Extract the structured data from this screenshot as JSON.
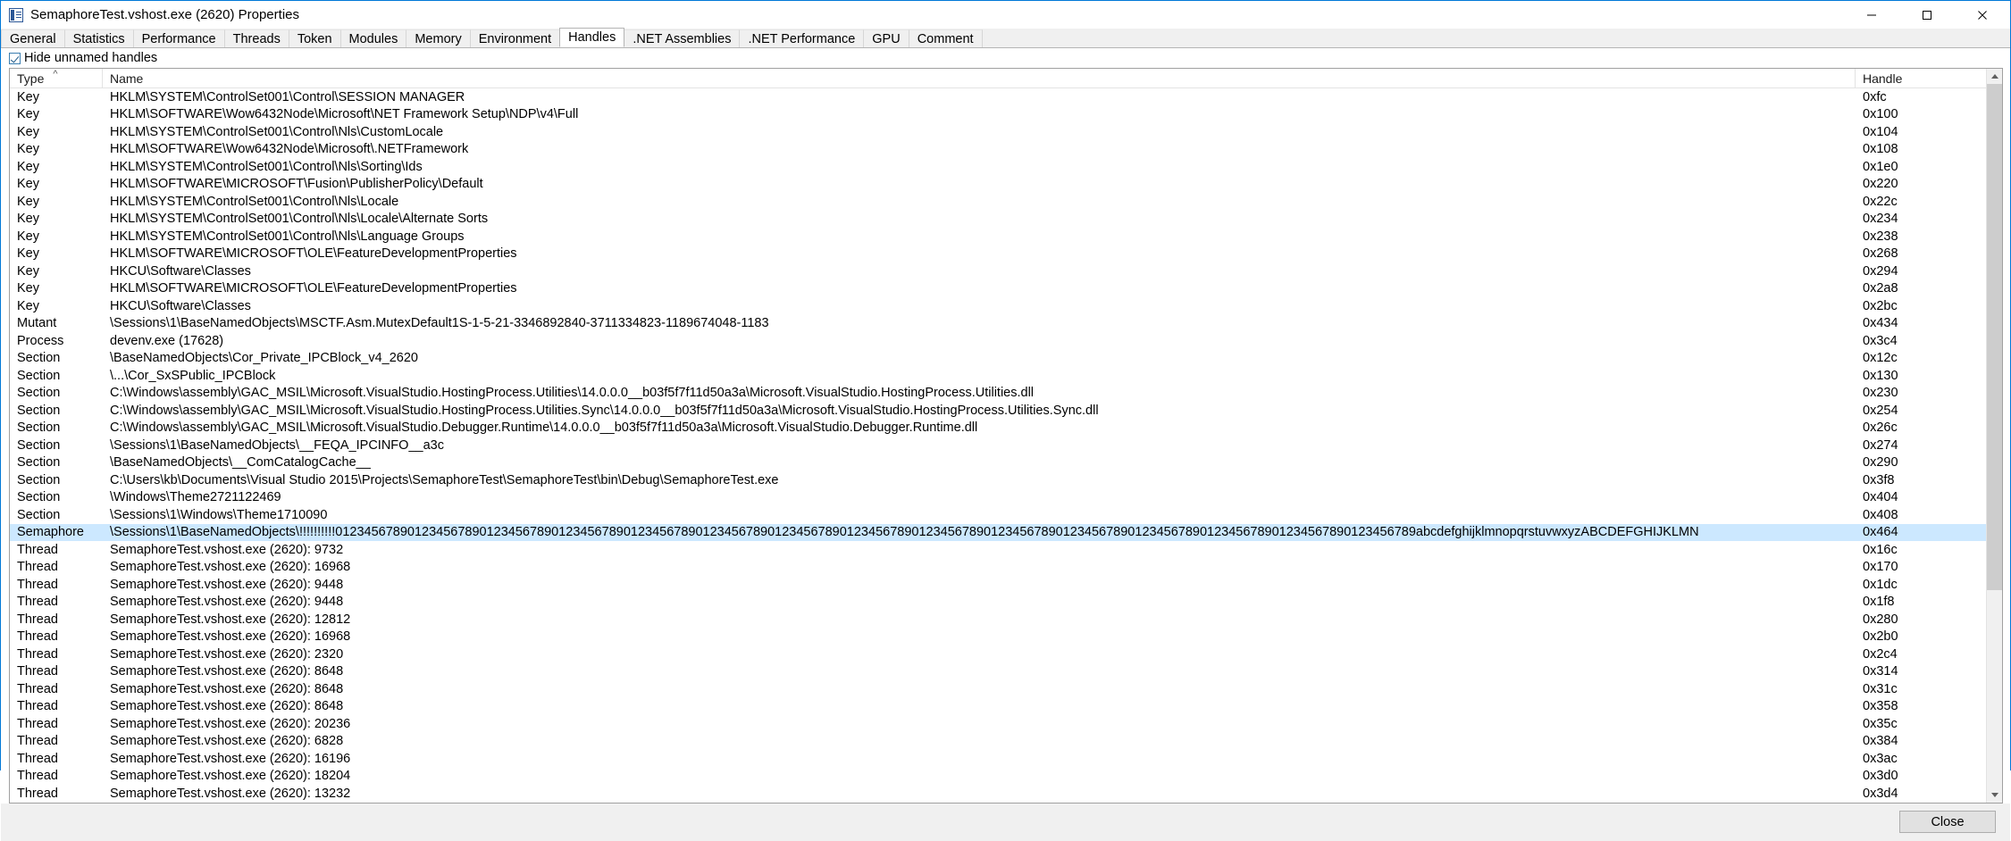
{
  "window": {
    "title": "SemaphoreTest.vshost.exe (2620) Properties",
    "icon": "process-properties-icon",
    "controls": {
      "minimize": "minimize-icon",
      "maximize": "maximize-icon",
      "close": "close-icon"
    },
    "accent_color": "#0078d7"
  },
  "tabs": [
    {
      "label": "General",
      "selected": false
    },
    {
      "label": "Statistics",
      "selected": false
    },
    {
      "label": "Performance",
      "selected": false
    },
    {
      "label": "Threads",
      "selected": false
    },
    {
      "label": "Token",
      "selected": false
    },
    {
      "label": "Modules",
      "selected": false
    },
    {
      "label": "Memory",
      "selected": false
    },
    {
      "label": "Environment",
      "selected": false
    },
    {
      "label": "Handles",
      "selected": true
    },
    {
      "label": ".NET Assemblies",
      "selected": false
    },
    {
      "label": ".NET Performance",
      "selected": false
    },
    {
      "label": "GPU",
      "selected": false
    },
    {
      "label": "Comment",
      "selected": false
    }
  ],
  "options": {
    "hide_unnamed_handles": {
      "label": "Hide unnamed handles",
      "checked": true
    }
  },
  "table": {
    "columns": [
      {
        "key": "type",
        "label": "Type",
        "sorted": "asc",
        "sort_glyph": "^"
      },
      {
        "key": "name",
        "label": "Name",
        "sorted": null,
        "sort_glyph": ""
      },
      {
        "key": "handle",
        "label": "Handle",
        "sorted": null,
        "sort_glyph": ""
      }
    ],
    "selected_row_color": "#cce8ff",
    "rows": [
      {
        "type": "Key",
        "name": "HKLM\\SYSTEM\\ControlSet001\\Control\\SESSION MANAGER",
        "handle": "0xfc",
        "selected": false
      },
      {
        "type": "Key",
        "name": "HKLM\\SOFTWARE\\Wow6432Node\\Microsoft\\NET Framework Setup\\NDP\\v4\\Full",
        "handle": "0x100",
        "selected": false
      },
      {
        "type": "Key",
        "name": "HKLM\\SYSTEM\\ControlSet001\\Control\\Nls\\CustomLocale",
        "handle": "0x104",
        "selected": false
      },
      {
        "type": "Key",
        "name": "HKLM\\SOFTWARE\\Wow6432Node\\Microsoft\\.NETFramework",
        "handle": "0x108",
        "selected": false
      },
      {
        "type": "Key",
        "name": "HKLM\\SYSTEM\\ControlSet001\\Control\\Nls\\Sorting\\Ids",
        "handle": "0x1e0",
        "selected": false
      },
      {
        "type": "Key",
        "name": "HKLM\\SOFTWARE\\MICROSOFT\\Fusion\\PublisherPolicy\\Default",
        "handle": "0x220",
        "selected": false
      },
      {
        "type": "Key",
        "name": "HKLM\\SYSTEM\\ControlSet001\\Control\\Nls\\Locale",
        "handle": "0x22c",
        "selected": false
      },
      {
        "type": "Key",
        "name": "HKLM\\SYSTEM\\ControlSet001\\Control\\Nls\\Locale\\Alternate Sorts",
        "handle": "0x234",
        "selected": false
      },
      {
        "type": "Key",
        "name": "HKLM\\SYSTEM\\ControlSet001\\Control\\Nls\\Language Groups",
        "handle": "0x238",
        "selected": false
      },
      {
        "type": "Key",
        "name": "HKLM\\SOFTWARE\\MICROSOFT\\OLE\\FeatureDevelopmentProperties",
        "handle": "0x268",
        "selected": false
      },
      {
        "type": "Key",
        "name": "HKCU\\Software\\Classes",
        "handle": "0x294",
        "selected": false
      },
      {
        "type": "Key",
        "name": "HKLM\\SOFTWARE\\MICROSOFT\\OLE\\FeatureDevelopmentProperties",
        "handle": "0x2a8",
        "selected": false
      },
      {
        "type": "Key",
        "name": "HKCU\\Software\\Classes",
        "handle": "0x2bc",
        "selected": false
      },
      {
        "type": "Mutant",
        "name": "\\Sessions\\1\\BaseNamedObjects\\MSCTF.Asm.MutexDefault1S-1-5-21-3346892840-3711334823-1189674048-1183",
        "handle": "0x434",
        "selected": false
      },
      {
        "type": "Process",
        "name": "devenv.exe (17628)",
        "handle": "0x3c4",
        "selected": false
      },
      {
        "type": "Section",
        "name": "\\BaseNamedObjects\\Cor_Private_IPCBlock_v4_2620",
        "handle": "0x12c",
        "selected": false
      },
      {
        "type": "Section",
        "name": "\\...\\Cor_SxSPublic_IPCBlock",
        "handle": "0x130",
        "selected": false
      },
      {
        "type": "Section",
        "name": "C:\\Windows\\assembly\\GAC_MSIL\\Microsoft.VisualStudio.HostingProcess.Utilities\\14.0.0.0__b03f5f7f11d50a3a\\Microsoft.VisualStudio.HostingProcess.Utilities.dll",
        "handle": "0x230",
        "selected": false
      },
      {
        "type": "Section",
        "name": "C:\\Windows\\assembly\\GAC_MSIL\\Microsoft.VisualStudio.HostingProcess.Utilities.Sync\\14.0.0.0__b03f5f7f11d50a3a\\Microsoft.VisualStudio.HostingProcess.Utilities.Sync.dll",
        "handle": "0x254",
        "selected": false
      },
      {
        "type": "Section",
        "name": "C:\\Windows\\assembly\\GAC_MSIL\\Microsoft.VisualStudio.Debugger.Runtime\\14.0.0.0__b03f5f7f11d50a3a\\Microsoft.VisualStudio.Debugger.Runtime.dll",
        "handle": "0x26c",
        "selected": false
      },
      {
        "type": "Section",
        "name": "\\Sessions\\1\\BaseNamedObjects\\__FEQA_IPCINFO__a3c",
        "handle": "0x274",
        "selected": false
      },
      {
        "type": "Section",
        "name": "\\BaseNamedObjects\\__ComCatalogCache__",
        "handle": "0x290",
        "selected": false
      },
      {
        "type": "Section",
        "name": "C:\\Users\\kb\\Documents\\Visual Studio 2015\\Projects\\SemaphoreTest\\SemaphoreTest\\bin\\Debug\\SemaphoreTest.exe",
        "handle": "0x3f8",
        "selected": false
      },
      {
        "type": "Section",
        "name": "\\Windows\\Theme2721122469",
        "handle": "0x404",
        "selected": false
      },
      {
        "type": "Section",
        "name": "\\Sessions\\1\\Windows\\Theme1710090",
        "handle": "0x408",
        "selected": false
      },
      {
        "type": "Semaphore",
        "name": "\\Sessions\\1\\BaseNamedObjects\\!!!!!!!!!!012345678901234567890123456789012345678901234567890123456789012345678901234567890123456789012345678901234567890123456789012345678901234567890123456789abcdefghijklmnopqrstuvwxyzABCDEFGHIJKLMN",
        "handle": "0x464",
        "selected": true
      },
      {
        "type": "Thread",
        "name": "SemaphoreTest.vshost.exe (2620): 9732",
        "handle": "0x16c",
        "selected": false
      },
      {
        "type": "Thread",
        "name": "SemaphoreTest.vshost.exe (2620): 16968",
        "handle": "0x170",
        "selected": false
      },
      {
        "type": "Thread",
        "name": "SemaphoreTest.vshost.exe (2620): 9448",
        "handle": "0x1dc",
        "selected": false
      },
      {
        "type": "Thread",
        "name": "SemaphoreTest.vshost.exe (2620): 9448",
        "handle": "0x1f8",
        "selected": false
      },
      {
        "type": "Thread",
        "name": "SemaphoreTest.vshost.exe (2620): 12812",
        "handle": "0x280",
        "selected": false
      },
      {
        "type": "Thread",
        "name": "SemaphoreTest.vshost.exe (2620): 16968",
        "handle": "0x2b0",
        "selected": false
      },
      {
        "type": "Thread",
        "name": "SemaphoreTest.vshost.exe (2620): 2320",
        "handle": "0x2c4",
        "selected": false
      },
      {
        "type": "Thread",
        "name": "SemaphoreTest.vshost.exe (2620): 8648",
        "handle": "0x314",
        "selected": false
      },
      {
        "type": "Thread",
        "name": "SemaphoreTest.vshost.exe (2620): 8648",
        "handle": "0x31c",
        "selected": false
      },
      {
        "type": "Thread",
        "name": "SemaphoreTest.vshost.exe (2620): 8648",
        "handle": "0x358",
        "selected": false
      },
      {
        "type": "Thread",
        "name": "SemaphoreTest.vshost.exe (2620): 20236",
        "handle": "0x35c",
        "selected": false
      },
      {
        "type": "Thread",
        "name": "SemaphoreTest.vshost.exe (2620): 6828",
        "handle": "0x384",
        "selected": false
      },
      {
        "type": "Thread",
        "name": "SemaphoreTest.vshost.exe (2620): 16196",
        "handle": "0x3ac",
        "selected": false
      },
      {
        "type": "Thread",
        "name": "SemaphoreTest.vshost.exe (2620): 18204",
        "handle": "0x3d0",
        "selected": false
      },
      {
        "type": "Thread",
        "name": "SemaphoreTest.vshost.exe (2620): 13232",
        "handle": "0x3d4",
        "selected": false
      }
    ]
  },
  "scrollbar": {
    "up_arrow": "scroll-up-arrow-icon",
    "down_arrow": "scroll-down-arrow-icon",
    "thumb_top_pct": 0,
    "thumb_height_pct": 72
  },
  "footer": {
    "close_label": "Close"
  }
}
